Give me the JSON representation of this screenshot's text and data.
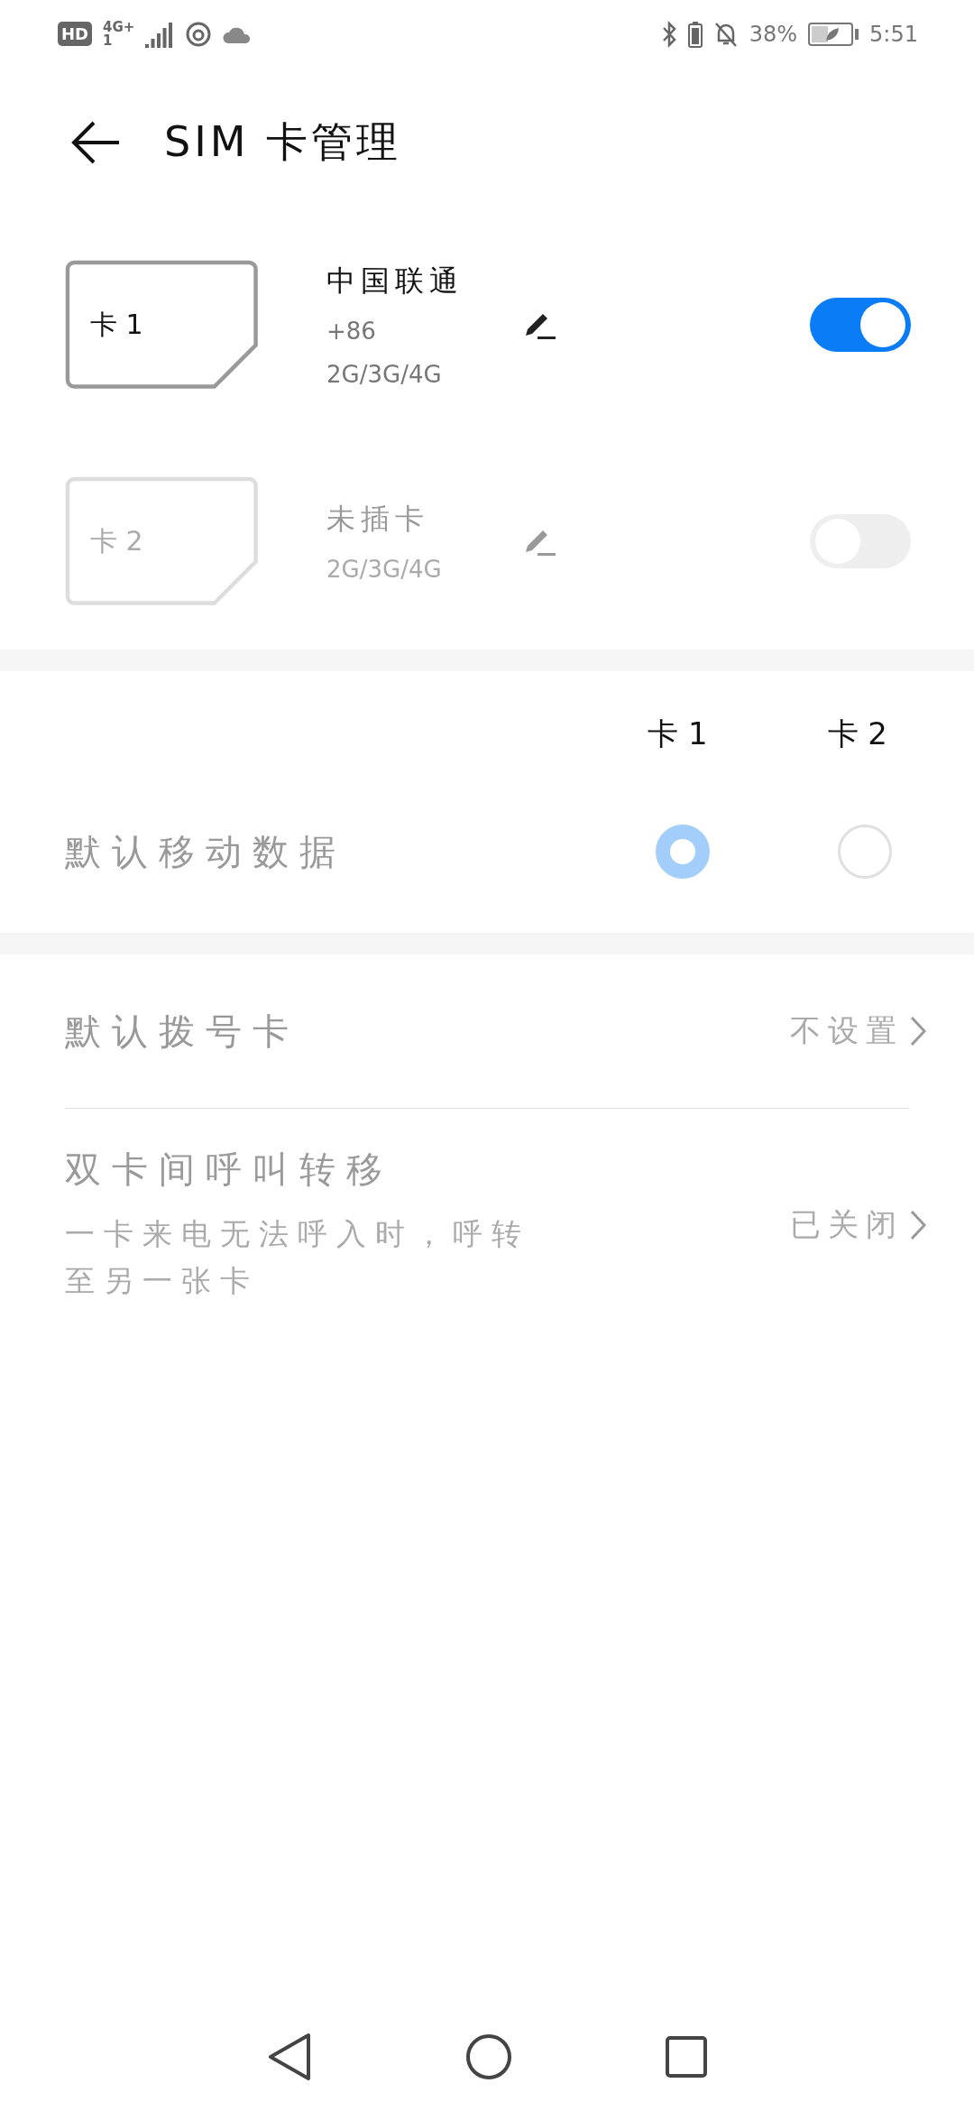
{
  "status_bar": {
    "hd_badge": "HD",
    "network": "4G+",
    "sim_slot": "1",
    "battery_percent": "38%",
    "time": "5:51"
  },
  "header": {
    "title": "SIM 卡管理"
  },
  "sims": [
    {
      "label": "卡 1",
      "name": "中国联通",
      "number": "+86",
      "network": "2G/3G/4G",
      "inserted": true,
      "on": true
    },
    {
      "label": "卡 2",
      "name": "未插卡",
      "network": "2G/3G/4G",
      "inserted": false,
      "on": false
    }
  ],
  "default_data": {
    "columns": [
      "卡 1",
      "卡 2"
    ],
    "label": "默认移动数据",
    "disabled": true,
    "options": [
      {
        "selected": true
      },
      {
        "selected": false
      }
    ]
  },
  "settings": [
    {
      "title": "默认拨号卡",
      "value": "不设置",
      "disabled": true
    },
    {
      "title": "双卡间呼叫转移",
      "description": "一卡来电无法呼入时，呼转至另一张卡",
      "value": "已关闭",
      "disabled": true
    }
  ]
}
